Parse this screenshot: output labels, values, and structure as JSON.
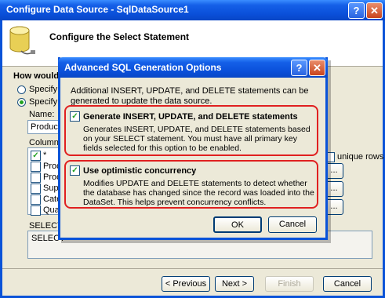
{
  "window": {
    "title": "Configure Data Source - SqlDataSource1",
    "help_label": "?",
    "close_label": "✕",
    "header": "Configure the Select Statement"
  },
  "background": {
    "how_label": "How would y",
    "option1": "Specify a",
    "option2": "Specify c",
    "name_label": "Name:",
    "name_value": "Products",
    "columns_label": "Columns:",
    "columns": [
      "*",
      "Prod",
      "Prod",
      "Supp",
      "Cate",
      "Quan"
    ],
    "unique_rows": "unique rows",
    "select_label": "SELECT s",
    "select_value": "SELECT",
    "side_button": "...",
    "buttons": {
      "previous": "< Previous",
      "next": "Next >",
      "finish": "Finish",
      "cancel": "Cancel"
    }
  },
  "dialog": {
    "title": "Advanced SQL Generation Options",
    "help_label": "?",
    "close_label": "✕",
    "description": "Additional INSERT, UPDATE, and DELETE statements can be generated to update the data source.",
    "options": [
      {
        "label": "Generate INSERT, UPDATE, and DELETE statements",
        "checked": true,
        "description": "Generates INSERT, UPDATE, and DELETE statements based on your SELECT statement. You must have all primary key fields selected for this option to be enabled."
      },
      {
        "label": "Use optimistic concurrency",
        "checked": true,
        "description": "Modifies UPDATE and DELETE statements to detect whether the database has changed since the record was loaded into the DataSet. This helps prevent concurrency conflicts."
      }
    ],
    "ok": "OK",
    "cancel": "Cancel"
  },
  "colors": {
    "titlebar": "#0a4fd9",
    "highlight": "#e02020",
    "check": "#21a121"
  }
}
